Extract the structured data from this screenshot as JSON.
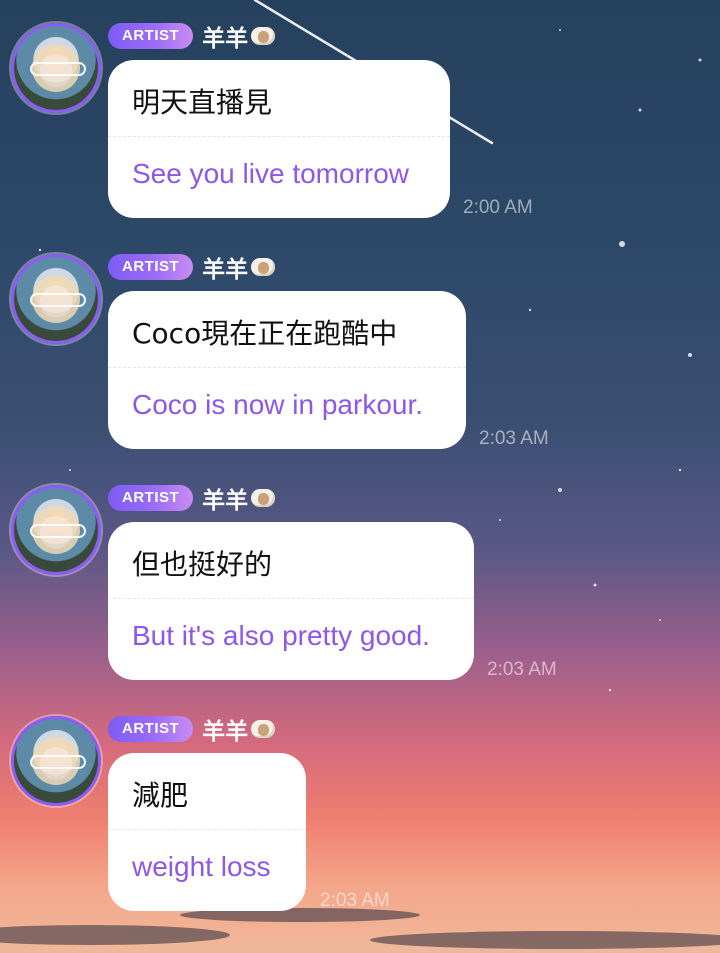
{
  "chat": {
    "messages": [
      {
        "badge": "ARTIST",
        "author": "羊羊",
        "original": "明天直播見",
        "translation": "See you live tomorrow",
        "time": "2:00 AM"
      },
      {
        "badge": "ARTIST",
        "author": "羊羊",
        "original": "Coco現在正在跑酷中",
        "translation": "Coco is now in parkour.",
        "time": "2:03 AM"
      },
      {
        "badge": "ARTIST",
        "author": "羊羊",
        "original": "但也挺好的",
        "translation": "But it's also pretty good.",
        "time": "2:03 AM"
      },
      {
        "badge": "ARTIST",
        "author": "羊羊",
        "original": "減肥",
        "translation": "weight loss",
        "time": "2:03 AM"
      }
    ]
  },
  "icons": {
    "author_suffix": "sheep-icon",
    "avatar": "avatar-image"
  },
  "colors": {
    "badge_gradient_start": "#7c5cf6",
    "badge_gradient_end": "#c98cf0",
    "translation_text": "#8d57e8",
    "avatar_ring": "#8b5cf6"
  }
}
